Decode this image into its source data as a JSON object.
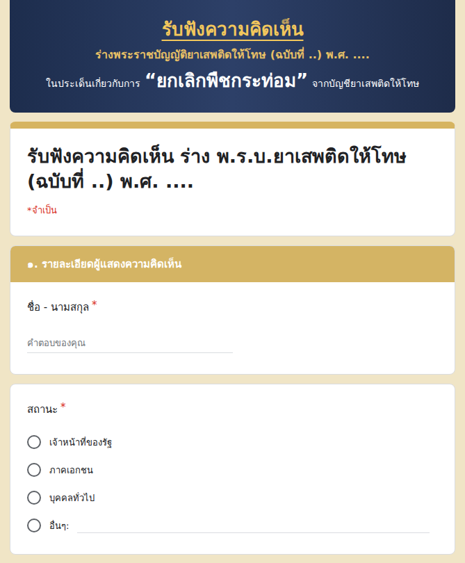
{
  "banner": {
    "title": "รับฟังความคิดเห็น",
    "subtitle": "ร่างพระราชบัญญัติยาเสพติดให้โทษ (ฉบับที่ ..) พ.ศ. ....",
    "line_prefix": "ในประเด็นเกี่ยวกับการ",
    "line_emphasis": "“ยกเลิกพืชกระท่อม”",
    "line_suffix": "จากบัญชียาเสพติดให้โทษ"
  },
  "form": {
    "title": "รับฟังความคิดเห็น ร่าง พ.ร.บ.ยาเสพติดให้โทษ (ฉบับที่ ..) พ.ศ. ....",
    "required_note": "*จำเป็น"
  },
  "section": {
    "title": "๑. รายละเอียดผู้แสดงความคิดเห็น"
  },
  "questions": [
    {
      "kind": "text",
      "label": "ชื่อ - นามสกุล",
      "required_mark": "*",
      "placeholder": "คำตอบของคุณ"
    },
    {
      "kind": "radio",
      "label": "สถานะ",
      "required_mark": "*",
      "options": [
        {
          "label": "เจ้าหน้าที่ของรัฐ",
          "selected": false,
          "kind": "plain"
        },
        {
          "label": "ภาคเอกชน",
          "selected": false,
          "kind": "plain"
        },
        {
          "label": "บุคคลทั่วไป",
          "selected": false,
          "kind": "plain"
        },
        {
          "label": "อื่นๆ:",
          "selected": false,
          "kind": "other"
        }
      ]
    }
  ]
}
